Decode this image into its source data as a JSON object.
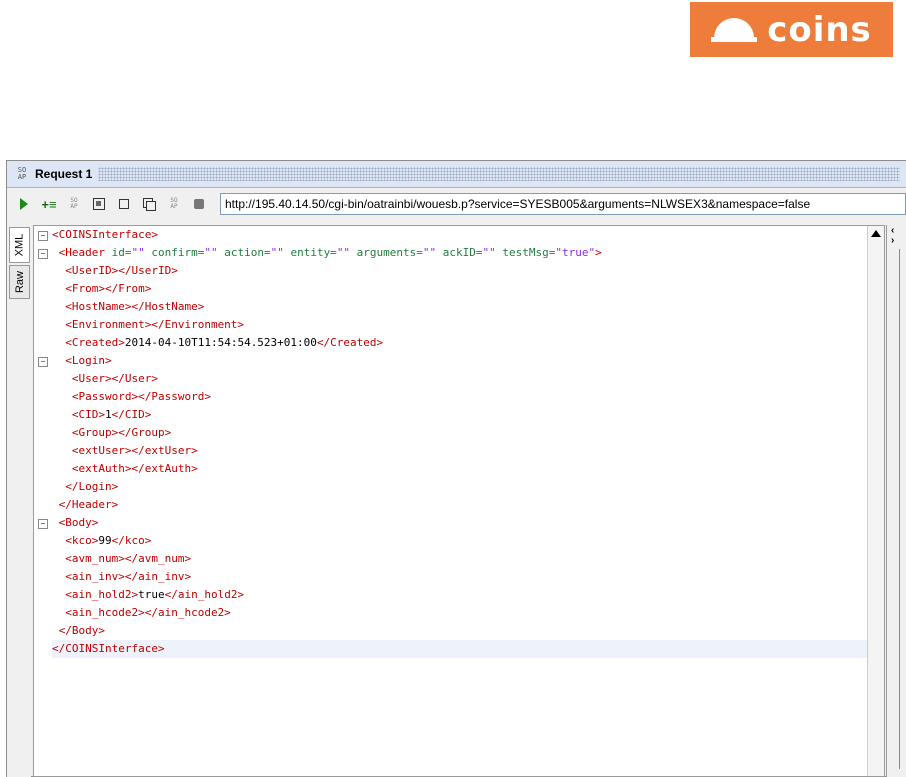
{
  "brand": {
    "logo_text": "coins",
    "color": "#ee7d3b"
  },
  "request": {
    "title": "Request 1",
    "soap_icon": "SO\nAP"
  },
  "toolbar": {
    "url": "http://195.40.14.50/cgi-bin/oatrainbi/wouesb.p?service=SYESB005&arguments=NLWSEX3&namespace=false",
    "icons": [
      "submit-icon",
      "add-wss-icon",
      "soap-icon",
      "wizard-icon",
      "new-window-icon",
      "clone-icon",
      "soap-version-icon",
      "stop-icon"
    ]
  },
  "sidetabs": {
    "xml": "XML",
    "raw": "Raw"
  },
  "colors": {
    "tag": "#c00000",
    "attribute": "#1f7f3f",
    "value": "#8a2be2",
    "text": "#000000"
  },
  "xml_lines": [
    {
      "fold": true,
      "parts": [
        {
          "t": "tag",
          "v": "<COINSInterface>"
        }
      ]
    },
    {
      "fold": true,
      "parts": [
        {
          "t": "tag",
          "v": " <Header "
        },
        {
          "t": "attr",
          "v": "id="
        },
        {
          "t": "val",
          "v": "\"\""
        },
        {
          "t": "attr",
          "v": " confirm="
        },
        {
          "t": "val",
          "v": "\"\""
        },
        {
          "t": "attr",
          "v": " action="
        },
        {
          "t": "val",
          "v": "\"\""
        },
        {
          "t": "attr",
          "v": " entity="
        },
        {
          "t": "val",
          "v": "\"\""
        },
        {
          "t": "attr",
          "v": " arguments="
        },
        {
          "t": "val",
          "v": "\"\""
        },
        {
          "t": "attr",
          "v": " ackID="
        },
        {
          "t": "val",
          "v": "\"\""
        },
        {
          "t": "attr",
          "v": " testMsg="
        },
        {
          "t": "val",
          "v": "\"true\""
        },
        {
          "t": "tag",
          "v": ">"
        }
      ]
    },
    {
      "fold": false,
      "parts": [
        {
          "t": "tag",
          "v": "  <UserID></UserID>"
        }
      ]
    },
    {
      "fold": false,
      "parts": [
        {
          "t": "tag",
          "v": "  <From></From>"
        }
      ]
    },
    {
      "fold": false,
      "parts": [
        {
          "t": "tag",
          "v": "  <HostName></HostName>"
        }
      ]
    },
    {
      "fold": false,
      "parts": [
        {
          "t": "tag",
          "v": "  <Environment></Environment>"
        }
      ]
    },
    {
      "fold": false,
      "parts": [
        {
          "t": "tag",
          "v": "  <Created>"
        },
        {
          "t": "txt",
          "v": "2014-04-10T11:54:54.523+01:00"
        },
        {
          "t": "tag",
          "v": "</Created>"
        }
      ]
    },
    {
      "fold": true,
      "parts": [
        {
          "t": "tag",
          "v": "  <Login>"
        }
      ]
    },
    {
      "fold": false,
      "parts": [
        {
          "t": "tag",
          "v": "   <User></User>"
        }
      ]
    },
    {
      "fold": false,
      "parts": [
        {
          "t": "tag",
          "v": "   <Password></Password>"
        }
      ]
    },
    {
      "fold": false,
      "parts": [
        {
          "t": "tag",
          "v": "   <CID>"
        },
        {
          "t": "txt",
          "v": "1"
        },
        {
          "t": "tag",
          "v": "</CID>"
        }
      ]
    },
    {
      "fold": false,
      "parts": [
        {
          "t": "tag",
          "v": "   <Group></Group>"
        }
      ]
    },
    {
      "fold": false,
      "parts": [
        {
          "t": "tag",
          "v": "   <extUser></extUser>"
        }
      ]
    },
    {
      "fold": false,
      "parts": [
        {
          "t": "tag",
          "v": "   <extAuth></extAuth>"
        }
      ]
    },
    {
      "fold": false,
      "parts": [
        {
          "t": "tag",
          "v": "  </Login>"
        }
      ]
    },
    {
      "fold": false,
      "parts": [
        {
          "t": "tag",
          "v": " </Header>"
        }
      ]
    },
    {
      "fold": true,
      "parts": [
        {
          "t": "tag",
          "v": " <Body>"
        }
      ]
    },
    {
      "fold": false,
      "parts": [
        {
          "t": "tag",
          "v": "  <kco>"
        },
        {
          "t": "txt",
          "v": "99"
        },
        {
          "t": "tag",
          "v": "</kco>"
        }
      ]
    },
    {
      "fold": false,
      "parts": [
        {
          "t": "tag",
          "v": "  <avm_num></avm_num>"
        }
      ]
    },
    {
      "fold": false,
      "parts": [
        {
          "t": "tag",
          "v": "  <ain_inv></ain_inv>"
        }
      ]
    },
    {
      "fold": false,
      "parts": [
        {
          "t": "tag",
          "v": "  <ain_hold2>"
        },
        {
          "t": "txt",
          "v": "true"
        },
        {
          "t": "tag",
          "v": "</ain_hold2>"
        }
      ]
    },
    {
      "fold": false,
      "parts": [
        {
          "t": "tag",
          "v": "  <ain_hcode2></ain_hcode2>"
        }
      ]
    },
    {
      "fold": false,
      "parts": [
        {
          "t": "tag",
          "v": " </Body>"
        }
      ]
    },
    {
      "fold": false,
      "highlight": true,
      "parts": [
        {
          "t": "tag",
          "v": "</COINSInterface>"
        }
      ]
    }
  ]
}
